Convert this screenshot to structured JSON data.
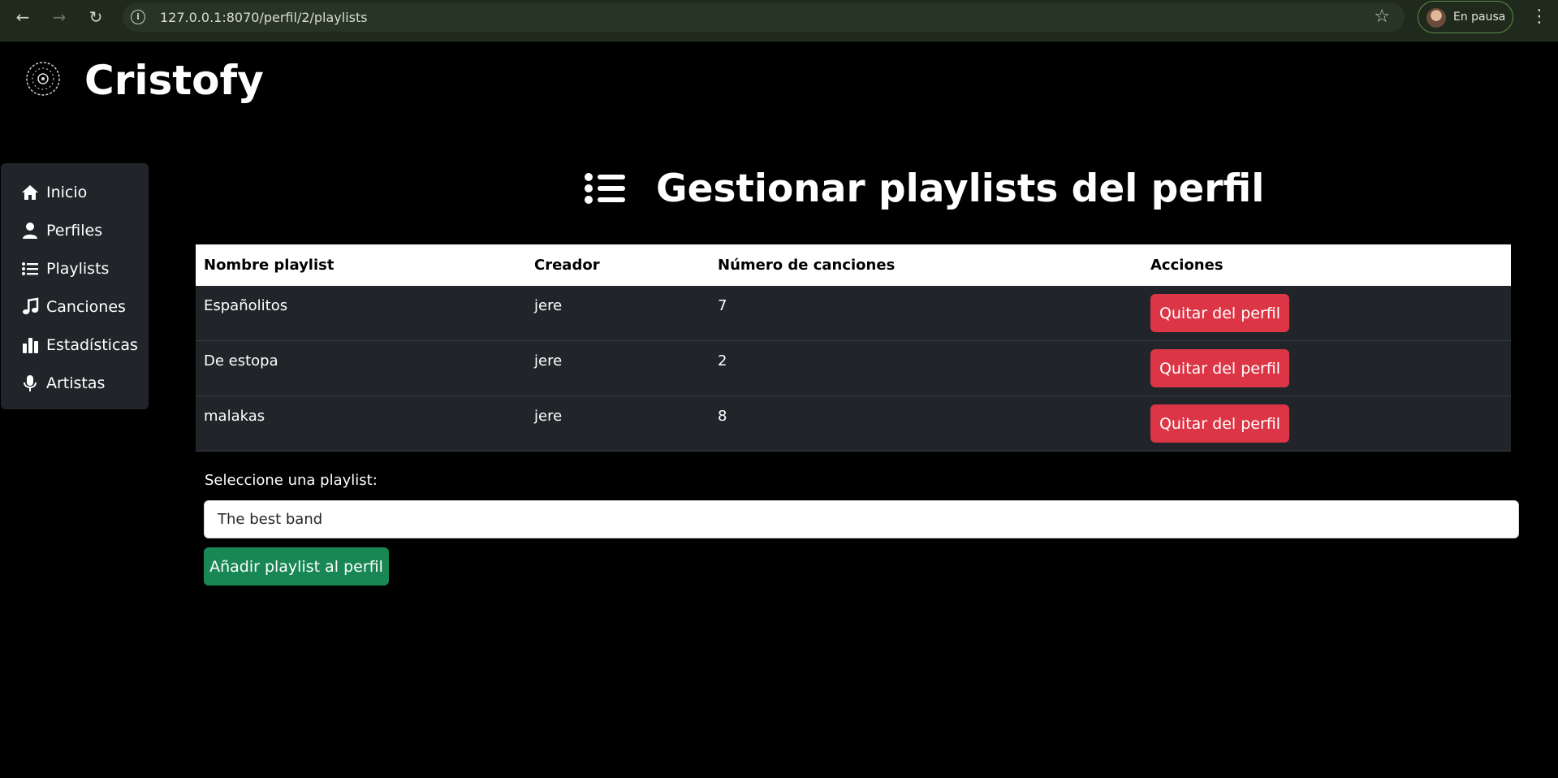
{
  "browser": {
    "url": "127.0.0.1:8070/perfil/2/playlists",
    "profile_label": "En pausa"
  },
  "app": {
    "brand": "Cristofy"
  },
  "sidebar": {
    "items": [
      {
        "label": "Inicio",
        "icon": "home-icon"
      },
      {
        "label": "Perfiles",
        "icon": "user-icon"
      },
      {
        "label": "Playlists",
        "icon": "list-icon"
      },
      {
        "label": "Canciones",
        "icon": "music-note-icon"
      },
      {
        "label": "Estadísticas",
        "icon": "bar-chart-icon"
      },
      {
        "label": "Artistas",
        "icon": "microphone-icon"
      }
    ]
  },
  "main": {
    "title": "Gestionar playlists del perfil",
    "table": {
      "headers": [
        "Nombre playlist",
        "Creador",
        "Número de canciones",
        "Acciones"
      ],
      "rows": [
        {
          "name": "Españolitos",
          "creator": "jere",
          "count": "7",
          "action": "Quitar del perfil"
        },
        {
          "name": "De estopa",
          "creator": "jere",
          "count": "2",
          "action": "Quitar del perfil"
        },
        {
          "name": "malakas",
          "creator": "jere",
          "count": "8",
          "action": "Quitar del perfil"
        }
      ]
    },
    "form": {
      "label": "Seleccione una playlist:",
      "selected": "The best band",
      "submit": "Añadir playlist al perfil"
    }
  },
  "colors": {
    "danger": "#dc3545",
    "success": "#198754",
    "sidebar_bg": "#212529"
  }
}
